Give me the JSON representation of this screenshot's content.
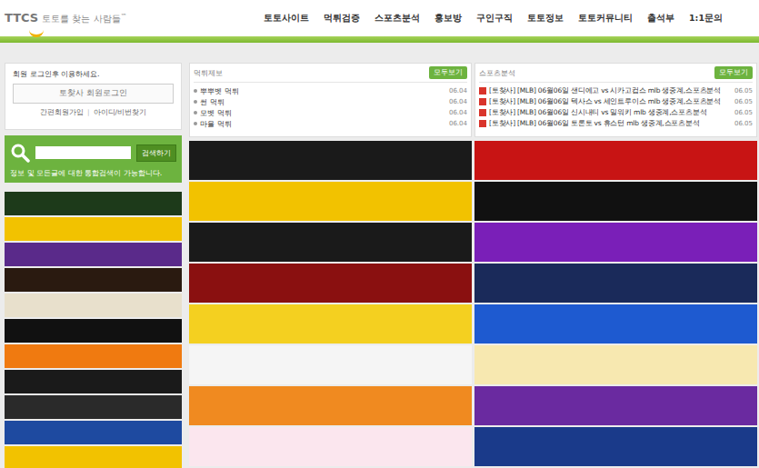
{
  "logo": {
    "name": "TTCS",
    "tagline": "토토를 찾는 사람들",
    "mark": "™"
  },
  "nav": [
    "토토사이트",
    "먹튀검증",
    "스포츠분석",
    "홍보방",
    "구인구직",
    "토토정보",
    "토토커뮤니티",
    "출석부",
    "1:1문의"
  ],
  "login": {
    "message": "회원 로그인후 이용하세요.",
    "button": "토찾사 회원로그인",
    "links": [
      "간편회원가입",
      "아이디/비번찾기"
    ],
    "separator": "|"
  },
  "search": {
    "button": "검색하기",
    "help": "정보 및 모든글에 대한 통합검색이 가능합니다."
  },
  "reports": {
    "title": "먹튀제보",
    "more": "모두보기",
    "items": [
      {
        "title": "뿌뿌벳 먹튀",
        "date": "06.04"
      },
      {
        "title": "썬 먹튀",
        "date": "06.04"
      },
      {
        "title": "모벳 먹튀",
        "date": "06.04"
      },
      {
        "title": "마을 먹튀",
        "date": "06.04"
      }
    ]
  },
  "analysis": {
    "title": "스포츠분석",
    "more": "모두보기",
    "items": [
      {
        "text": "[토찾사] [MLB] 06월06일 샌디에고 vs 시카고컵스 mlb 생중계,스포츠분석",
        "date": "06.05"
      },
      {
        "text": "[토찾사] [MLB] 06월06일 텍사스 vs 세인트루이스 mlb 생중계,스포츠분석",
        "date": "06.05"
      },
      {
        "text": "[토찾사] [MLB] 06월06일 신시내티 vs 밀워키 mlb 생중계,스포츠분석",
        "date": "06.05"
      },
      {
        "text": "[토찾사] [MLB] 06월06일 토론토 vs 휴스턴 mlb 생중계,스포츠분석",
        "date": "06.05"
      }
    ]
  },
  "side_banners": [
    {
      "color": "#1d3a1a"
    },
    {
      "color": "#f2c200"
    },
    {
      "color": "#5a2a8a"
    },
    {
      "color": "#2a1a10"
    },
    {
      "color": "#e8e0cc"
    },
    {
      "color": "#111111"
    },
    {
      "color": "#f07a10"
    },
    {
      "color": "#1a1a1a"
    },
    {
      "color": "#2a2a2a"
    },
    {
      "color": "#1e4aa0"
    },
    {
      "color": "#f2c200"
    }
  ],
  "banners": [
    {
      "color": "#1a1a1a"
    },
    {
      "color": "#c81414"
    },
    {
      "color": "#f2c200"
    },
    {
      "color": "#111111"
    },
    {
      "color": "#1a1a1a"
    },
    {
      "color": "#7a1fb8"
    },
    {
      "color": "#8a1010"
    },
    {
      "color": "#1a2a5a"
    },
    {
      "color": "#f4d020"
    },
    {
      "color": "#1e5ad0"
    },
    {
      "color": "#f5f5f5"
    },
    {
      "color": "#f7e8b0"
    },
    {
      "color": "#f08a20"
    },
    {
      "color": "#6a2aa0"
    },
    {
      "color": "#fbe6ee"
    },
    {
      "color": "#1a3a8a"
    }
  ]
}
